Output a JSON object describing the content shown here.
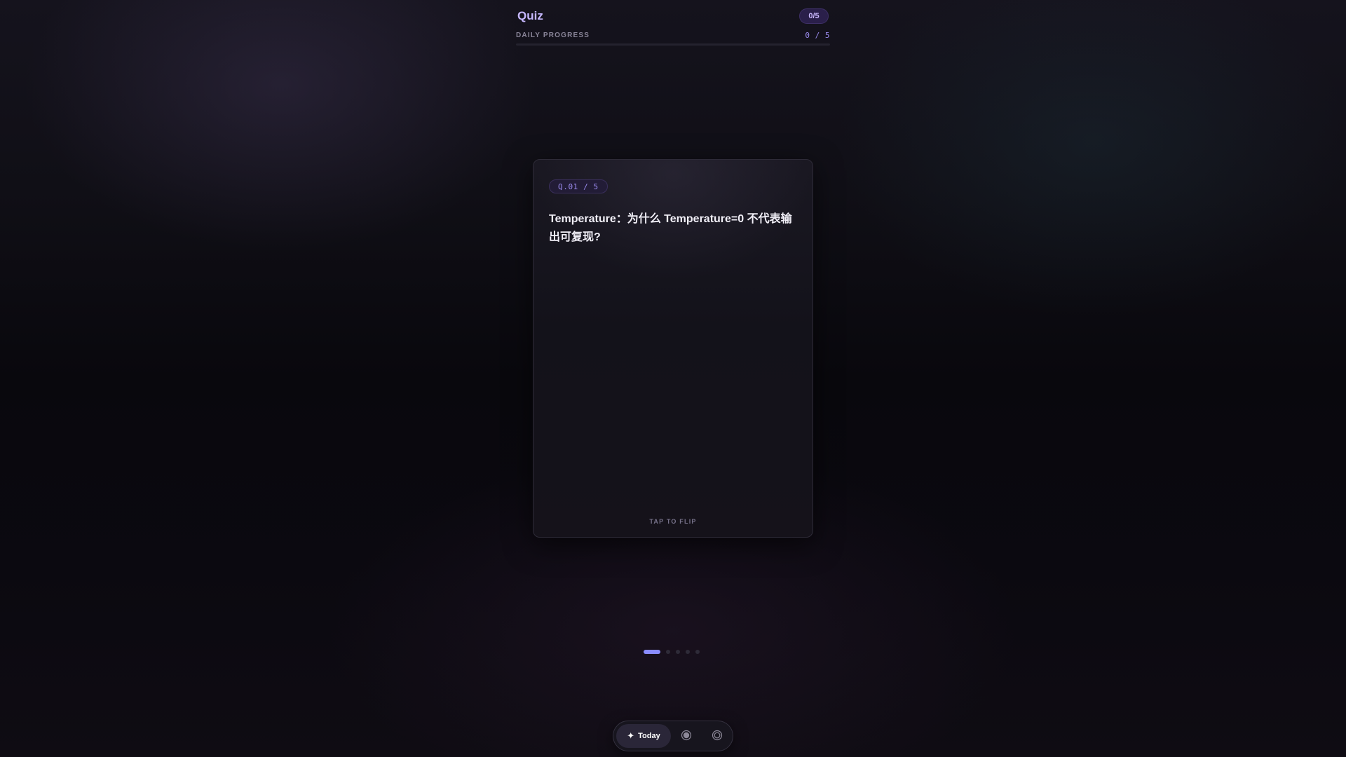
{
  "header": {
    "title": "Quiz",
    "score_badge": "0/5",
    "progress_label": "DAILY PROGRESS",
    "progress_count": "0 / 5",
    "progress_fraction": 0
  },
  "card": {
    "question_tag": "Q.01 / 5",
    "question": "Temperature：为什么 Temperature=0 不代表输出可复现?",
    "flip_hint": "TAP TO FLIP"
  },
  "pagination": {
    "total": 5,
    "active_index": 0
  },
  "nav": {
    "today_icon": "sparkle-icon",
    "today_label": "Today",
    "items": [
      {
        "icon": "record-icon"
      },
      {
        "icon": "target-icon"
      }
    ]
  },
  "colors": {
    "accent": "#9c8cf0",
    "active_dot": "#8a8cff",
    "title": "#c6b8ff"
  }
}
